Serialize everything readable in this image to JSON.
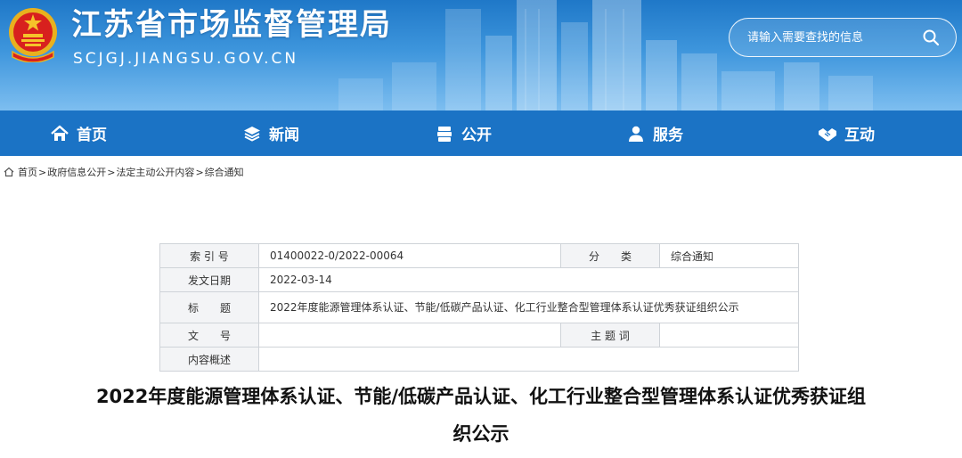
{
  "header": {
    "title": "江苏省市场监督管理局",
    "domain": "SCJGJ.JIANGSU.GOV.CN",
    "search_placeholder": "请输入需要查找的信息"
  },
  "nav": {
    "items": [
      {
        "label": "首页",
        "icon": "home-icon"
      },
      {
        "label": "新闻",
        "icon": "layers-icon"
      },
      {
        "label": "公开",
        "icon": "document-stack-icon"
      },
      {
        "label": "服务",
        "icon": "user-service-icon"
      },
      {
        "label": "互动",
        "icon": "handshake-icon"
      }
    ]
  },
  "breadcrumb": [
    "首页",
    "政府信息公开",
    "法定主动公开内容",
    "综合通知"
  ],
  "info": {
    "index_label": "索 引 号",
    "index_value": "01400022-0/2022-00064",
    "category_label": "分　　类",
    "category_value": "综合通知",
    "date_label": "发文日期",
    "date_value": "2022-03-14",
    "title_label": "标　　题",
    "title_value": "2022年度能源管理体系认证、节能/低碳产品认证、化工行业整合型管理体系认证优秀获证组织公示",
    "docno_label": "文　　号",
    "docno_value": "",
    "keywords_label": "主 题 词",
    "keywords_value": "",
    "summary_label": "内容概述",
    "summary_value": ""
  },
  "article": {
    "title": "2022年度能源管理体系认证、节能/低碳产品认证、化工行业整合型管理体系认证优秀获证组织公示"
  },
  "colors": {
    "header_blue": "#2a86d4",
    "nav_blue": "#1b73c5",
    "label_bg": "#f3f4f6",
    "border": "#cfd3d8"
  }
}
